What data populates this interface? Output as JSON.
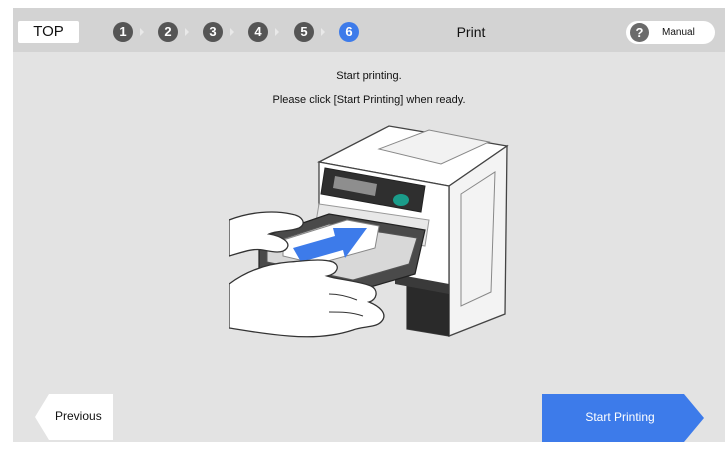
{
  "header": {
    "top_label": "TOP",
    "steps": [
      "1",
      "2",
      "3",
      "4",
      "5",
      "6"
    ],
    "active_step": "6",
    "title": "Print",
    "manual": {
      "icon_glyph": "?",
      "label": "Manual"
    }
  },
  "main": {
    "instruction_line1": "Start printing.",
    "instruction_line2": "Please click [Start Printing] when ready."
  },
  "footer": {
    "previous_label": "Previous",
    "start_label": "Start Printing"
  },
  "colors": {
    "accent": "#3d7bea",
    "background": "#e3e3e3",
    "header": "#d3d3d3"
  }
}
